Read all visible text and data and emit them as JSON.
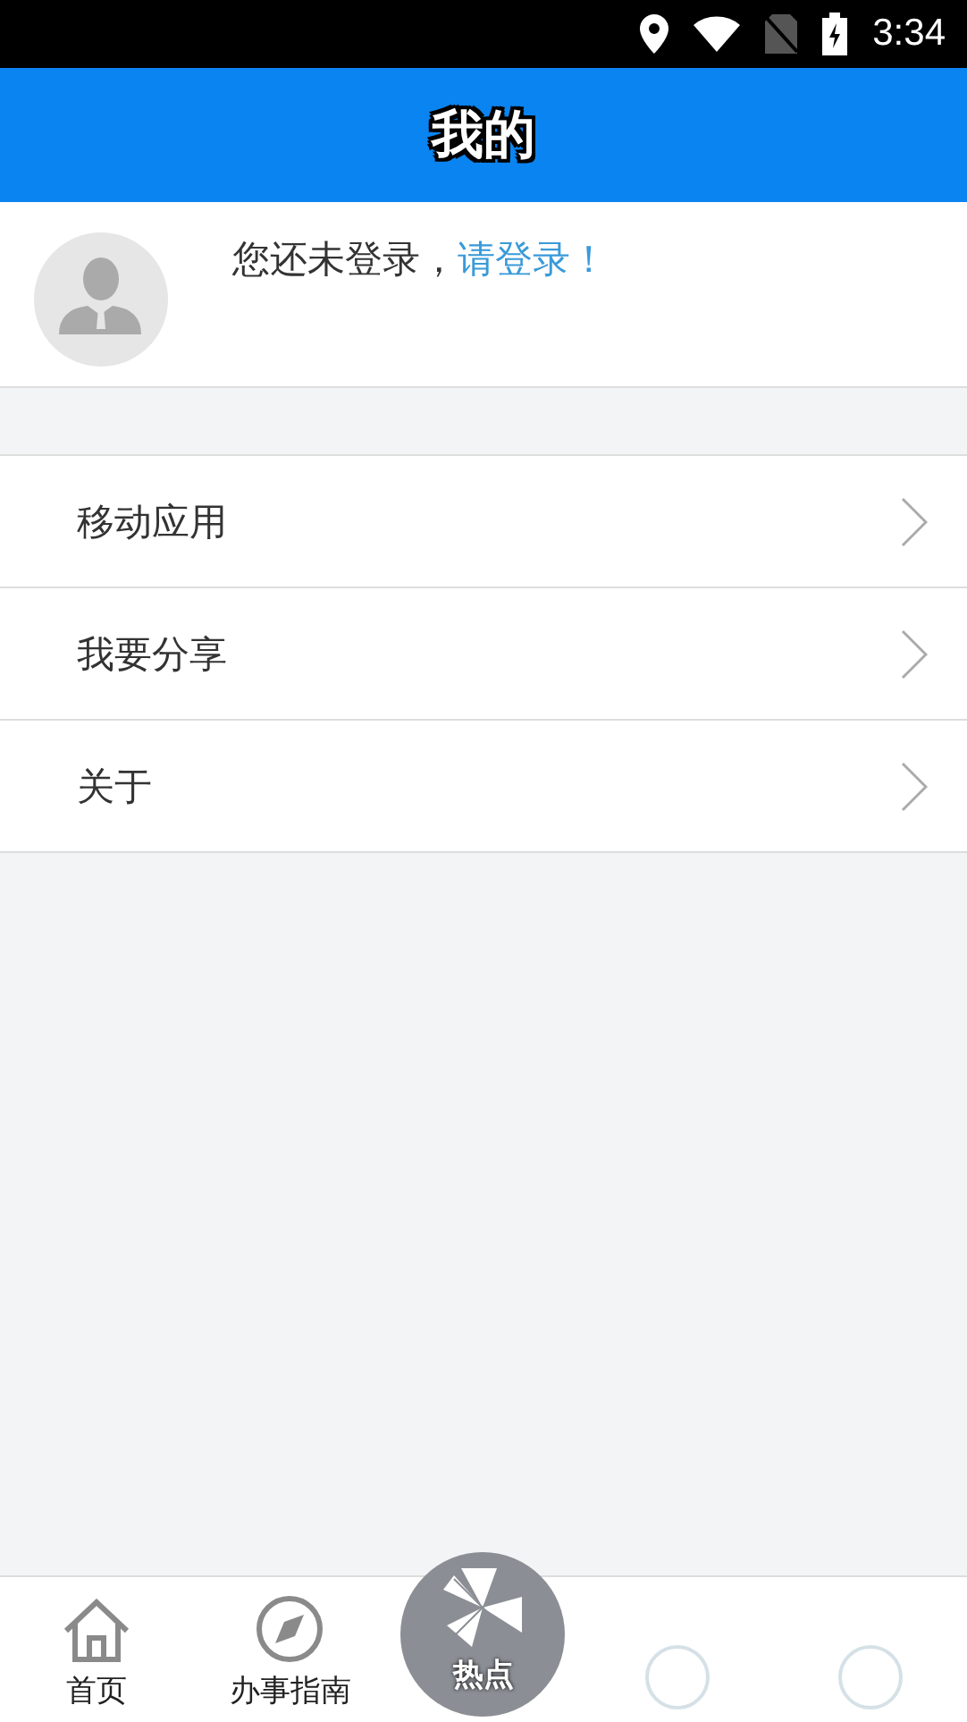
{
  "status_bar": {
    "time": "3:34"
  },
  "header": {
    "title": "我的"
  },
  "profile": {
    "prompt": "您还未登录，",
    "login_link": "请登录！"
  },
  "menu": [
    {
      "label": "移动应用"
    },
    {
      "label": "我要分享"
    },
    {
      "label": "关于"
    }
  ],
  "tab_bar": [
    {
      "kind": "home",
      "label": "首页"
    },
    {
      "kind": "compass",
      "label": "办事指南"
    },
    {
      "kind": "center",
      "label": "热点"
    },
    {
      "kind": "ring"
    },
    {
      "kind": "ring"
    }
  ]
}
